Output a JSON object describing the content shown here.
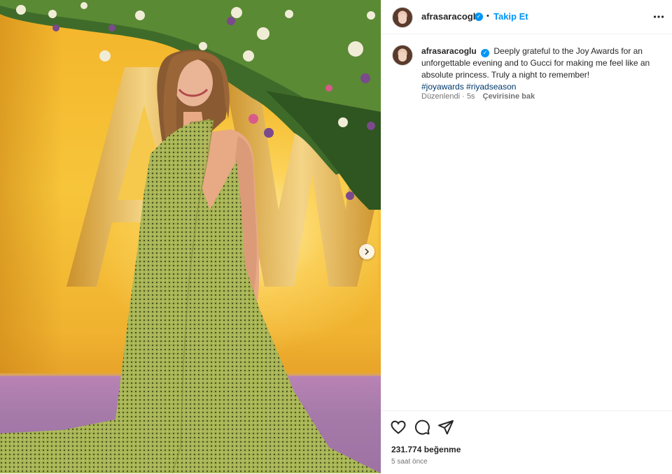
{
  "post": {
    "username": "afrasaracoglu",
    "separator": "•",
    "follow_label": "Takip Et",
    "verified_mark": "✓",
    "caption_text": "Deeply grateful to the Joy Awards for an unforgettable evening and to Gucci for making me feel like an absolute princess. Truly a night to remember!",
    "hashtags": [
      "#joyawards",
      "#riyadseason"
    ],
    "edited_label": "Düzenlendi · 5s",
    "translate_label": "Çevirisine bak",
    "likes_text": "231.774 beğenme",
    "timestamp": "5 saat önce"
  },
  "icons": {
    "more": "more-options-icon",
    "like": "heart-icon",
    "comment": "comment-icon",
    "share": "share-icon",
    "next": "chevron-right-icon",
    "verified": "verified-badge-icon"
  },
  "colors": {
    "accent": "#0095f6",
    "hashtag": "#00376b",
    "muted": "#737373",
    "text": "#262626",
    "background_wall": "#f3b42a",
    "carpet": "#a57aa9"
  }
}
